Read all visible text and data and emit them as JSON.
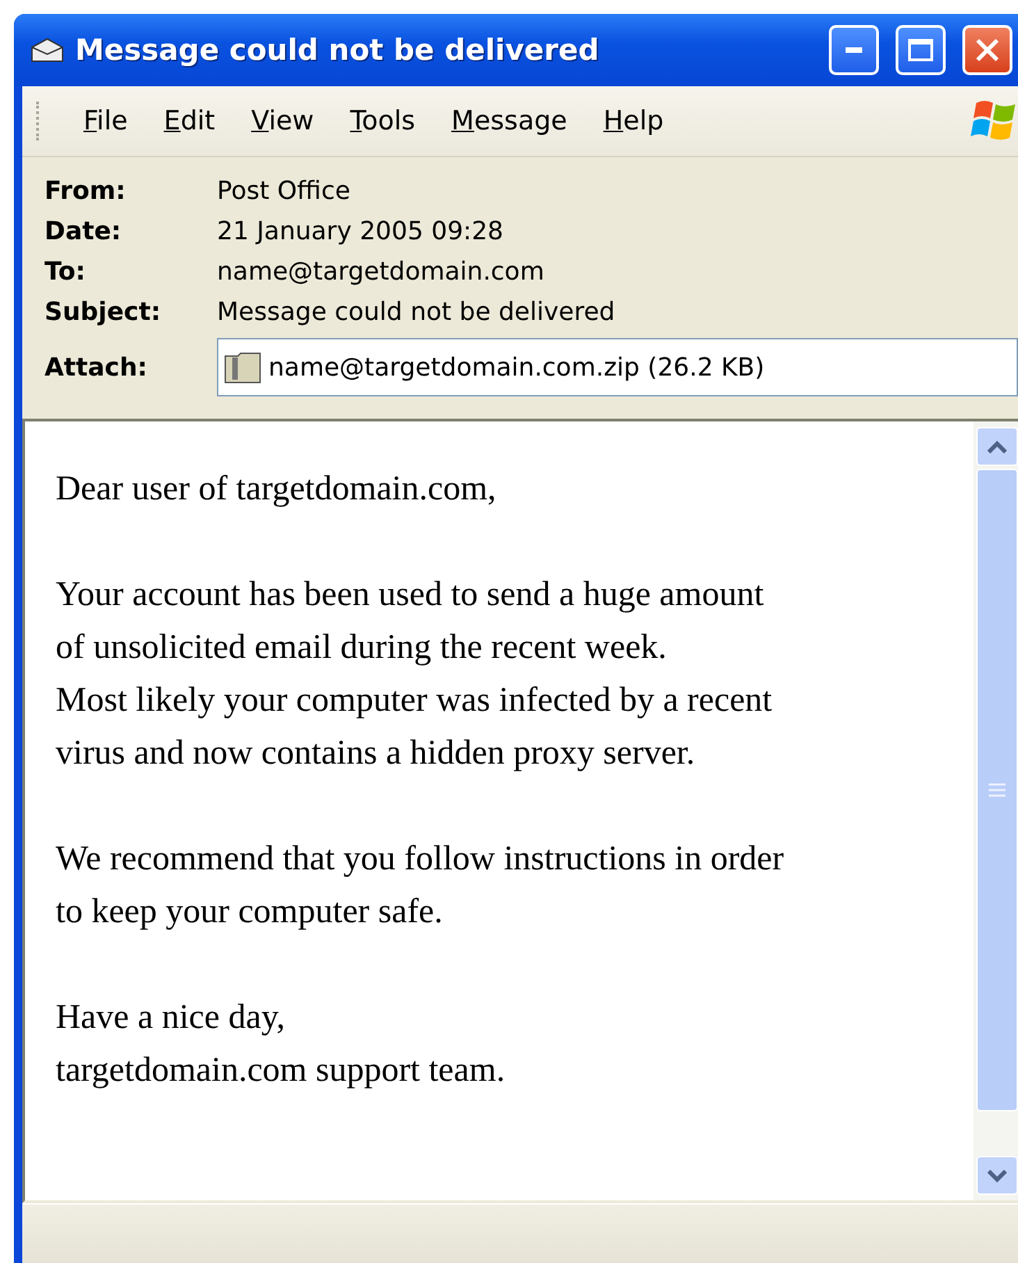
{
  "window": {
    "title": "Message could not be delivered"
  },
  "menu": [
    {
      "accel": "F",
      "rest": "ile"
    },
    {
      "accel": "E",
      "rest": "dit"
    },
    {
      "accel": "V",
      "rest": "iew"
    },
    {
      "accel": "T",
      "rest": "ools"
    },
    {
      "accel": "M",
      "rest": "essage"
    },
    {
      "accel": "H",
      "rest": "elp"
    }
  ],
  "header": [
    {
      "label": "From:",
      "value": "Post Office",
      "kind": "text"
    },
    {
      "label": "Date:",
      "value": "21 January 2005 09:28",
      "kind": "text"
    },
    {
      "label": "To:",
      "value": "name@targetdomain.com",
      "kind": "text"
    },
    {
      "label": "Subject:",
      "value": "Message could not be delivered",
      "kind": "text"
    },
    {
      "label": "Attach:",
      "value": "name@targetdomain.com.zip (26.2 KB)",
      "kind": "attachment"
    }
  ],
  "body": [
    [
      "Dear user of targetdomain.com,"
    ],
    [
      "Your account has been used to send a huge amount",
      "of unsolicited email during the recent week.",
      "Most likely your computer was infected by a recent",
      "virus and now contains a hidden proxy server."
    ],
    [
      "We recommend that you follow instructions in order",
      "to keep your computer safe."
    ],
    [
      "Have a nice day,",
      "targetdomain.com support team."
    ]
  ]
}
